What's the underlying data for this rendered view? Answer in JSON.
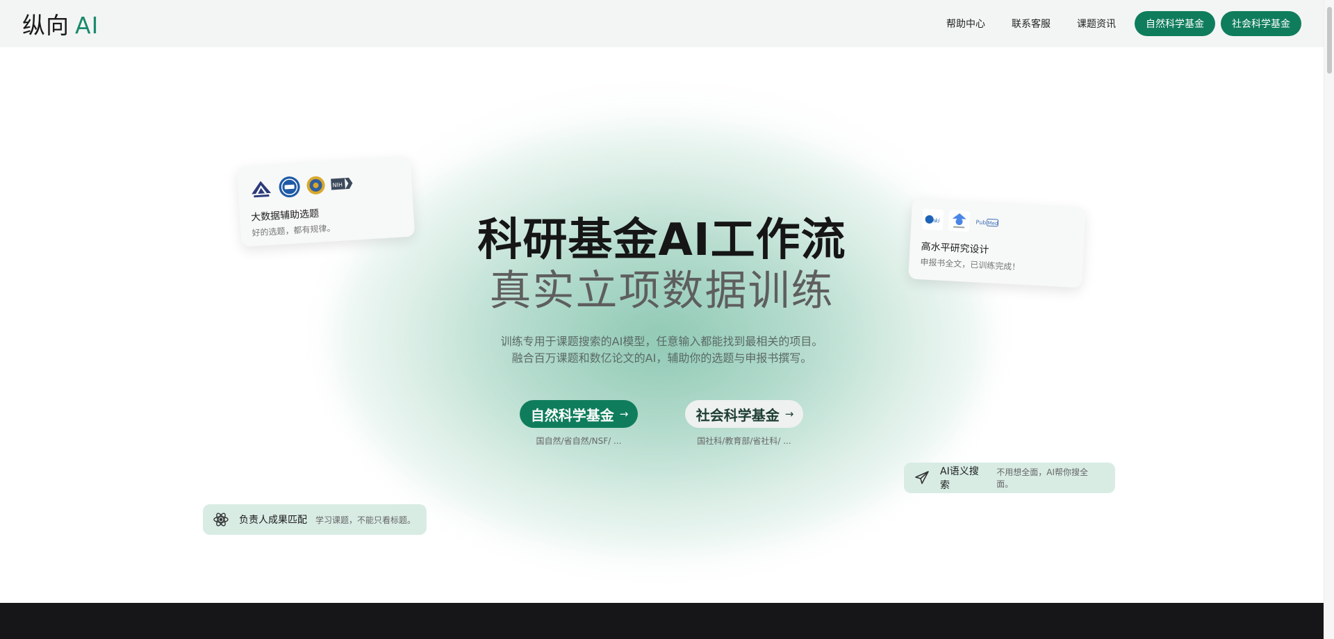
{
  "header": {
    "logo_cn": "纵向",
    "logo_ai": "AI",
    "nav_links": [
      "帮助中心",
      "联系客服",
      "课题资讯"
    ],
    "nav_buttons": [
      "自然科学基金",
      "社会科学基金"
    ]
  },
  "hero": {
    "title_line1": "科研基金AI工作流",
    "title_line2": "真实立项数据训练",
    "subtitle_line1": "训练专用于课题搜索的AI模型，任意输入都能找到最相关的项目。",
    "subtitle_line2": "融合百万课题和数亿论文的AI，辅助你的选题与申报书撰写。",
    "cta_primary": {
      "label": "自然科学基金",
      "arrow": "→",
      "sub": "国自然/省自然/NSF/ ..."
    },
    "cta_secondary": {
      "label": "社会科学基金",
      "arrow": "→",
      "sub": "国社科/教育部/省社科/ ..."
    }
  },
  "cards": {
    "left": {
      "title": "大数据辅助选题",
      "desc": "好的选题，都有规律。",
      "logos": [
        "NSFC",
        "NSSFC",
        "MOE",
        "NIH"
      ]
    },
    "right": {
      "title": "高水平研究设计",
      "desc": "申报书全文，已训练完成！",
      "logos": [
        "CNKI",
        "Google Scholar",
        "PubMed"
      ]
    }
  },
  "pills": {
    "left": {
      "icon": "atom-icon",
      "title": "负责人成果匹配",
      "desc": "学习课题，不能只看标题。"
    },
    "right": {
      "icon": "paper-plane-icon",
      "title": "AI语义搜索",
      "desc": "不用想全面，AI帮你搜全面。"
    }
  },
  "colors": {
    "brand_green": "#0f7d5c",
    "logo_ai": "#1b8a6b",
    "pill_bg": "#d8ece4",
    "footer": "#161618"
  }
}
